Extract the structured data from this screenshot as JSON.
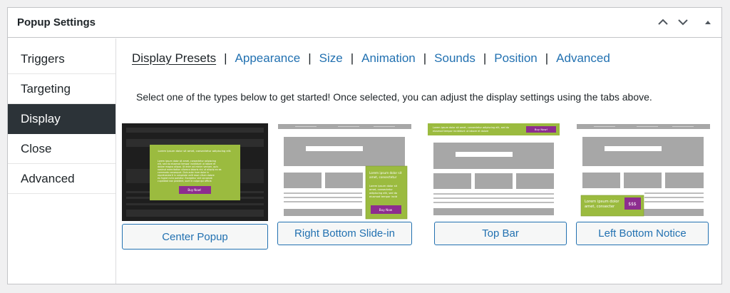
{
  "panel": {
    "title": "Popup Settings"
  },
  "header_buttons": {
    "up": "chevron-up",
    "down": "chevron-down",
    "toggle": "triangle-up"
  },
  "sidebar": {
    "items": [
      {
        "label": "Triggers"
      },
      {
        "label": "Targeting"
      },
      {
        "label": "Display",
        "active": true
      },
      {
        "label": "Close"
      },
      {
        "label": "Advanced"
      }
    ]
  },
  "tabs": [
    {
      "label": "Display Presets",
      "active": true
    },
    {
      "label": "Appearance"
    },
    {
      "label": "Size"
    },
    {
      "label": "Animation"
    },
    {
      "label": "Sounds"
    },
    {
      "label": "Position"
    },
    {
      "label": "Advanced"
    }
  ],
  "tab_separator": "|",
  "intro_text": "Select one of the types below to get started! Once selected, you can adjust the display settings using the tabs above.",
  "presets": [
    {
      "label": "Center Popup",
      "selected": true,
      "thumb": {
        "heading": "Lorem ipsum dolor sit amet, consectetur adipiscing elit.",
        "body": [
          "Lorem ipsum dolor sit amet, consectetur adipiscing",
          "elit, sed do eiusmod tempor incididunt ut labore et",
          "dolore magna aliqua. Ut enim ad minim veniam, quis",
          "nostrud exercitation ullamco laboris nisi ut aliquip ex ea",
          "commodo consequat. Duis aute irure dolor in",
          "reprehenderit in voluptate velit esse cillum dolore",
          "eu fugiat nulla pariatur. Excepteur sint occaecat",
          "cupidatat non proident, sunt in culpa qui officia"
        ],
        "button": "Buy Now!"
      }
    },
    {
      "label": "Right Bottom Slide-in",
      "thumb": {
        "heading": [
          "Lorem ipsum dolor sit",
          "amet, consectetur"
        ],
        "body": [
          "Lorem ipsum dolor sit",
          "amet, consectetur",
          "adipiscing elit, sed do",
          "eiusmod tempor incid"
        ],
        "button": "Buy Now"
      }
    },
    {
      "label": "Top Bar",
      "thumb": {
        "text": [
          "Lorem ipsum dolor sit amet, consectetur adipiscing elit, sed do",
          "eiusmod tempor incididunt ut labore et dolore"
        ],
        "button": "Buy Now!"
      }
    },
    {
      "label": "Left Bottom Notice",
      "thumb": {
        "text": [
          "Lorem ipsum dolor",
          "amet, consecter"
        ],
        "button": "$$$"
      }
    }
  ],
  "colors": {
    "accent": "#2271b1",
    "dark": "#2c3338",
    "popup_green": "#9bbb3f",
    "popup_button": "#8d2d8f",
    "mock_gray": "#a7a7a7"
  }
}
